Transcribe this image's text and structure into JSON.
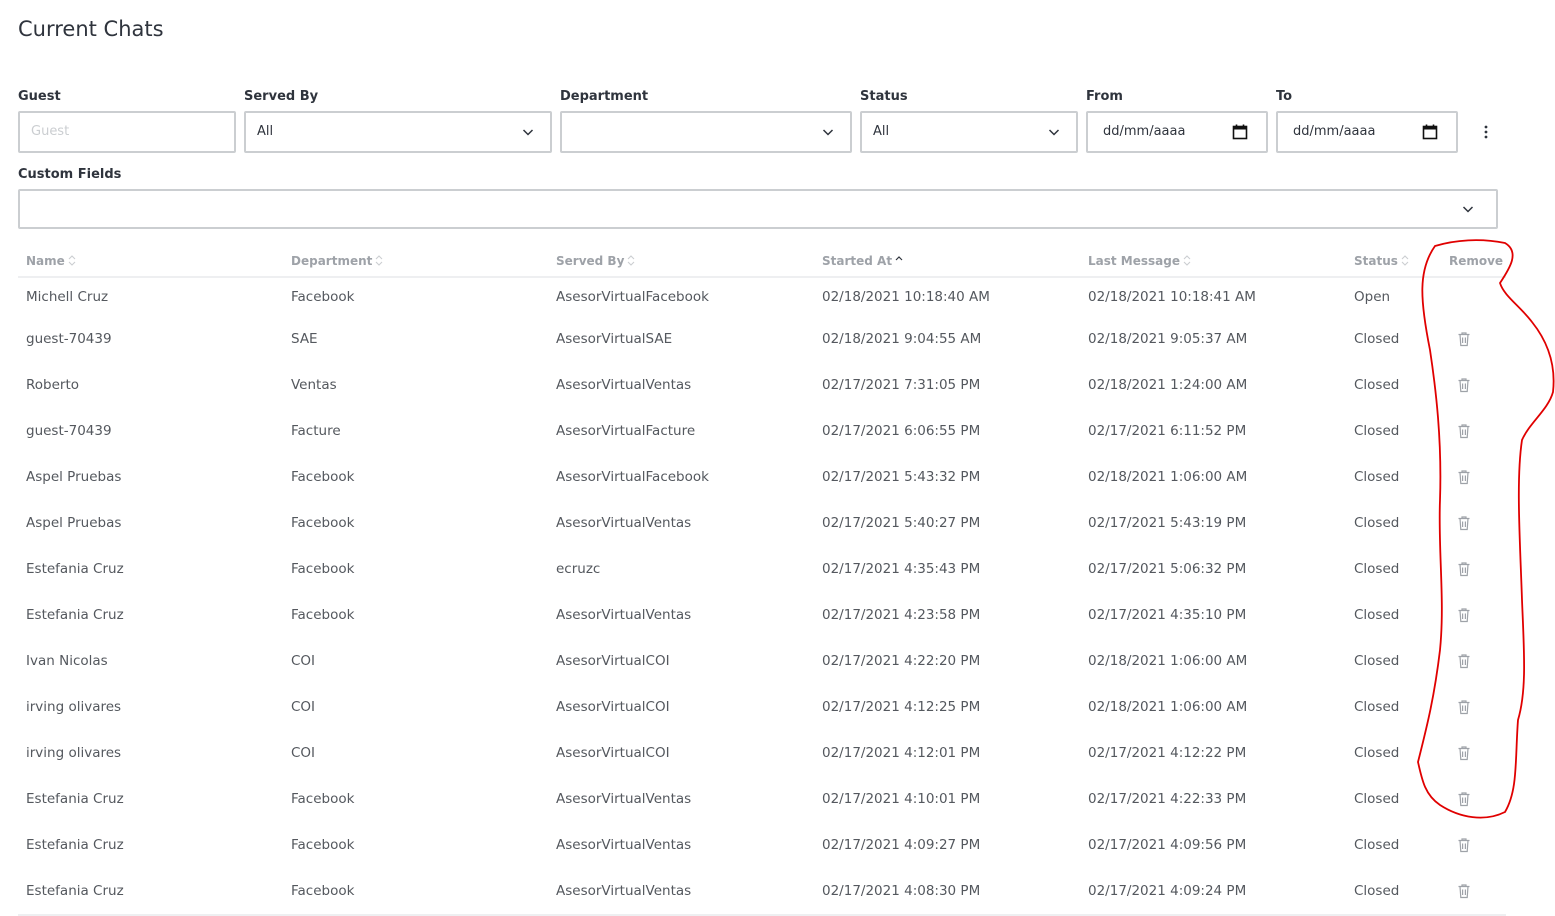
{
  "page": {
    "title": "Current Chats"
  },
  "filters": {
    "guest": {
      "label": "Guest",
      "placeholder": "Guest",
      "value": ""
    },
    "served_by": {
      "label": "Served By",
      "value": "All"
    },
    "department": {
      "label": "Department",
      "value": ""
    },
    "status": {
      "label": "Status",
      "value": "All"
    },
    "from": {
      "label": "From",
      "value": "dd/mm/aaaa"
    },
    "to": {
      "label": "To",
      "value": "dd/mm/aaaa"
    },
    "custom_fields": {
      "label": "Custom Fields",
      "value": ""
    }
  },
  "table": {
    "columns": [
      "Name",
      "Department",
      "Served By",
      "Started At",
      "Last Message",
      "Status",
      "Remove"
    ],
    "rows": [
      [
        "Michell Cruz",
        "Facebook",
        "AsesorVirtualFacebook",
        "02/18/2021 10:18:40 AM",
        "02/18/2021 10:18:41 AM",
        "Open"
      ],
      [
        "guest-70439",
        "SAE",
        "AsesorVirtualSAE",
        "02/18/2021 9:04:55 AM",
        "02/18/2021 9:05:37 AM",
        "Closed"
      ],
      [
        "Roberto",
        "Ventas",
        "AsesorVirtualVentas",
        "02/17/2021 7:31:05 PM",
        "02/18/2021 1:24:00 AM",
        "Closed"
      ],
      [
        "guest-70439",
        "Facture",
        "AsesorVirtualFacture",
        "02/17/2021 6:06:55 PM",
        "02/17/2021 6:11:52 PM",
        "Closed"
      ],
      [
        "Aspel Pruebas",
        "Facebook",
        "AsesorVirtualFacebook",
        "02/17/2021 5:43:32 PM",
        "02/18/2021 1:06:00 AM",
        "Closed"
      ],
      [
        "Aspel Pruebas",
        "Facebook",
        "AsesorVirtualVentas",
        "02/17/2021 5:40:27 PM",
        "02/17/2021 5:43:19 PM",
        "Closed"
      ],
      [
        "Estefania Cruz",
        "Facebook",
        "ecruzc",
        "02/17/2021 4:35:43 PM",
        "02/17/2021 5:06:32 PM",
        "Closed"
      ],
      [
        "Estefania Cruz",
        "Facebook",
        "AsesorVirtualVentas",
        "02/17/2021 4:23:58 PM",
        "02/17/2021 4:35:10 PM",
        "Closed"
      ],
      [
        "Ivan Nicolas",
        "COI",
        "AsesorVirtualCOI",
        "02/17/2021 4:22:20 PM",
        "02/18/2021 1:06:00 AM",
        "Closed"
      ],
      [
        "irving olivares",
        "COI",
        "AsesorVirtualCOI",
        "02/17/2021 4:12:25 PM",
        "02/18/2021 1:06:00 AM",
        "Closed"
      ],
      [
        "irving olivares",
        "COI",
        "AsesorVirtualCOI",
        "02/17/2021 4:12:01 PM",
        "02/17/2021 4:12:22 PM",
        "Closed"
      ],
      [
        "Estefania Cruz",
        "Facebook",
        "AsesorVirtualVentas",
        "02/17/2021 4:10:01 PM",
        "02/17/2021 4:22:33 PM",
        "Closed"
      ],
      [
        "Estefania Cruz",
        "Facebook",
        "AsesorVirtualVentas",
        "02/17/2021 4:09:27 PM",
        "02/17/2021 4:09:56 PM",
        "Closed"
      ],
      [
        "Estefania Cruz",
        "Facebook",
        "AsesorVirtualVentas",
        "02/17/2021 4:08:30 PM",
        "02/17/2021 4:09:24 PM",
        "Closed"
      ]
    ]
  },
  "icons": {
    "sort": "sort-icon",
    "sort_active": "sort-ascending-icon",
    "chevron": "chevron-down-icon",
    "calendar": "calendar-icon",
    "more": "kebab-menu-icon",
    "remove": "trash-icon"
  },
  "colors": {
    "text": "#2f343d",
    "muted_header": "#9ea2a8",
    "border": "#cbced1",
    "annotation": "#e00000"
  }
}
